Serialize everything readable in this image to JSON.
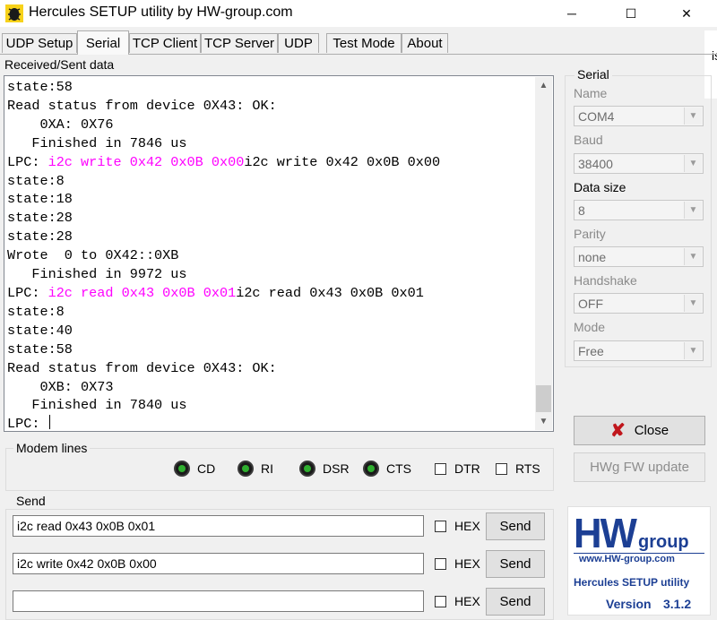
{
  "window": {
    "title": "Hercules SETUP utility by HW-group.com",
    "minimize": "─",
    "maximize": "☐",
    "close": "✕"
  },
  "tabs": [
    "UDP Setup",
    "Serial",
    "TCP Client",
    "TCP Server",
    "UDP",
    "Test Mode",
    "About"
  ],
  "received": {
    "label": "Received/Sent data",
    "lines": [
      {
        "t": "state:58"
      },
      {
        "t": "Read status from device 0X43: OK:"
      },
      {
        "t": "    0XA: 0X76"
      },
      {
        "t": "   Finished in 7846 us"
      },
      {
        "p": "LPC: ",
        "m": "i2c write 0x42 0x0B 0x00",
        "s": "i2c write 0x42 0x0B 0x00"
      },
      {
        "t": "state:8"
      },
      {
        "t": "state:18"
      },
      {
        "t": "state:28"
      },
      {
        "t": "state:28"
      },
      {
        "t": "Wrote  0 to 0X42::0XB"
      },
      {
        "t": "   Finished in 9972 us"
      },
      {
        "p": "LPC: ",
        "m": "i2c read 0x43 0x0B 0x01",
        "s": "i2c read 0x43 0x0B 0x01"
      },
      {
        "t": "state:8"
      },
      {
        "t": "state:40"
      },
      {
        "t": "state:58"
      },
      {
        "t": "Read status from device 0X43: OK:"
      },
      {
        "t": "    0XB: 0X73"
      },
      {
        "t": "   Finished in 7840 us"
      },
      {
        "p": "LPC: ",
        "caret": true
      }
    ]
  },
  "modem": {
    "title": "Modem lines",
    "leds": [
      "CD",
      "RI",
      "DSR",
      "CTS"
    ],
    "checks": [
      "DTR",
      "RTS"
    ]
  },
  "serial": {
    "title": "Serial",
    "name_label": "Name",
    "name_value": "COM4",
    "baud_label": "Baud",
    "baud_value": "38400",
    "datasize_label": "Data size",
    "datasize_value": "8",
    "parity_label": "Parity",
    "parity_value": "none",
    "handshake_label": "Handshake",
    "handshake_value": "OFF",
    "mode_label": "Mode",
    "mode_value": "Free",
    "close_label": "Close",
    "hwg_label": "HWg FW update"
  },
  "send": {
    "title": "Send",
    "rows": [
      {
        "value": "i2c read 0x43 0x0B 0x01",
        "hex": "HEX",
        "button": "Send"
      },
      {
        "value": "i2c write 0x42 0x0B 0x00",
        "hex": "HEX",
        "button": "Send"
      },
      {
        "value": "",
        "hex": "HEX",
        "button": "Send"
      }
    ]
  },
  "logo": {
    "hw": "HW",
    "group": "group",
    "url": "www.HW-group.com",
    "product": "Hercules SETUP utility",
    "version_label": "Version",
    "version": "3.1.2"
  },
  "edge": {
    "fragment": "is"
  },
  "colors": {
    "magenta": "#ff00ff",
    "led_green": "#2faf2f",
    "close_x": "#c0161c",
    "logo_blue": "#1c3f94"
  }
}
